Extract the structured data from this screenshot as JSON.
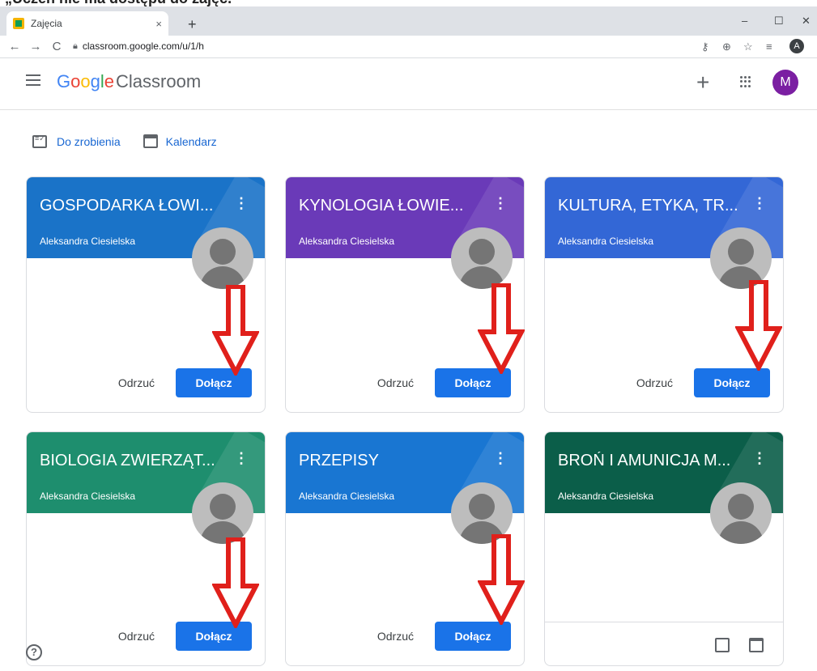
{
  "top_caption": "„Uczeń nie ma dostępu do zajęć.",
  "browser": {
    "tab_title": "Zajęcia",
    "tab_close": "×",
    "new_tab": "+",
    "url": "classroom.google.com/u/1/h",
    "profile_initial": "A",
    "win_min": "–",
    "win_max": "☐",
    "win_close": "✕"
  },
  "header": {
    "logo_google": [
      "G",
      "o",
      "o",
      "g",
      "l",
      "e"
    ],
    "logo_classroom": "Classroom",
    "add_symbol": "+",
    "user_initial": "M"
  },
  "subnav": {
    "todo_label": "Do zrobienia",
    "calendar_label": "Kalendarz"
  },
  "cards": [
    {
      "title": "GOSPODARKA ŁOWI...",
      "teacher": "Aleksandra Ciesielska",
      "color": "#1a73c8",
      "reject": "Odrzuć",
      "join": "Dołącz"
    },
    {
      "title": "KYNOLOGIA ŁOWIE...",
      "teacher": "Aleksandra Ciesielska",
      "color": "#6a3ab8",
      "reject": "Odrzuć",
      "join": "Dołącz"
    },
    {
      "title": "KULTURA, ETYKA, TR...",
      "teacher": "Aleksandra Ciesielska",
      "color": "#3367d6",
      "reject": "Odrzuć",
      "join": "Dołącz"
    },
    {
      "title": "BIOLOGIA ZWIERZĄT...",
      "teacher": "Aleksandra Ciesielska",
      "color": "#1e8e6e",
      "reject": "Odrzuć",
      "join": "Dołącz"
    },
    {
      "title": "PRZEPISY",
      "teacher": "Aleksandra Ciesielska",
      "color": "#1976d2",
      "reject": "Odrzuć",
      "join": "Dołącz"
    },
    {
      "title": "BROŃ I AMUNICJA M...",
      "teacher": "Aleksandra Ciesielska",
      "color": "#0b5e49"
    }
  ],
  "help_symbol": "?",
  "arrow_color": "#e0201b"
}
